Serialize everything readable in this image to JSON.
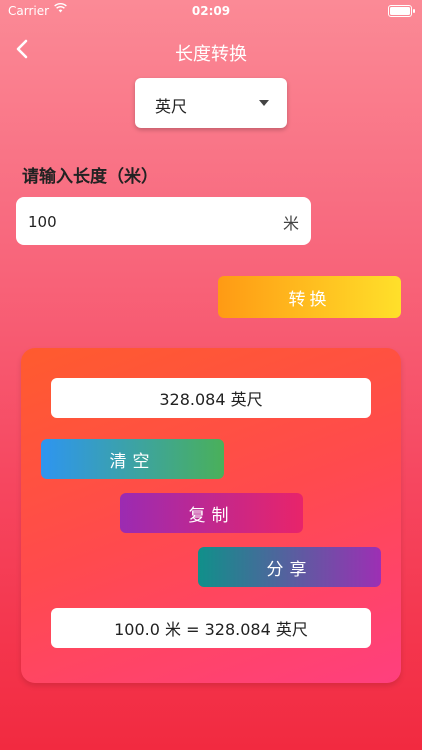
{
  "status_bar": {
    "carrier": "Carrier",
    "time": "02:09"
  },
  "nav": {
    "title": "长度转换",
    "back_icon": "chevron-left-icon"
  },
  "unit_select": {
    "selected": "英尺"
  },
  "input": {
    "label": "请输入长度（米）",
    "value": "100",
    "unit": "米"
  },
  "convert_button": {
    "label": "转换",
    "colors": [
      "#ff9a14",
      "#ffe02a"
    ]
  },
  "result": {
    "value_text": "328.084 英尺",
    "summary_text": "100.0 米 = 328.084 英尺"
  },
  "actions": {
    "clear_label": "清空",
    "copy_label": "复制",
    "share_label": "分享"
  },
  "colors": {
    "background_top": "#fb8a96",
    "background_bottom": "#f22a40",
    "card": "#ff4a4e"
  }
}
